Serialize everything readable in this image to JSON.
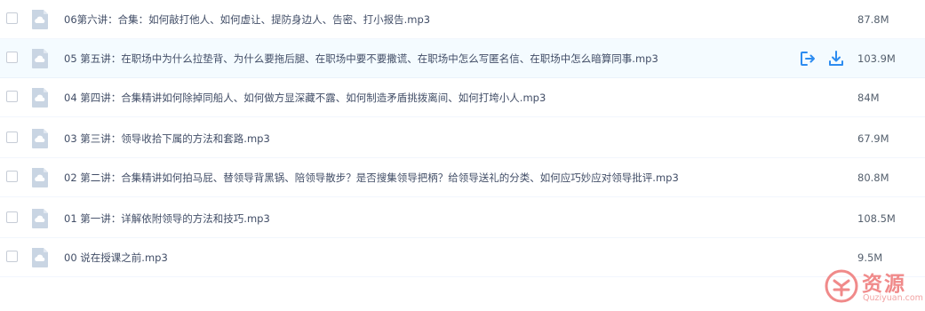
{
  "files": [
    {
      "name": "06第六讲：合集：如何敲打他人、如何虚让、提防身边人、告密、打小报告.mp3",
      "size": "87.8M",
      "hover": false
    },
    {
      "name": "05 第五讲：在职场中为什么拉垫背、为什么要拖后腿、在职场中要不要撒谎、在职场中怎么写匿名信、在职场中怎么暗算同事.mp3",
      "size": "103.9M",
      "hover": true
    },
    {
      "name": "04 第四讲：合集精讲如何除掉同船人、如何做方显深藏不露、如何制造矛盾挑拨离间、如何打垮小人.mp3",
      "size": "84M",
      "hover": false
    },
    {
      "name": "03 第三讲：领导收拾下属的方法和套路.mp3",
      "size": "67.9M",
      "hover": false
    },
    {
      "name": "02 第二讲：合集精讲如何拍马屁、替领导背黑锅、陪领导散步？是否搜集领导把柄？给领导送礼的分类、如何应巧妙应对领导批评.mp3",
      "size": "80.8M",
      "hover": false
    },
    {
      "name": "01 第一讲：详解依附领导的方法和技巧.mp3",
      "size": "108.5M",
      "hover": false
    },
    {
      "name": "00 说在授课之前.mp3",
      "size": "9.5M",
      "hover": false
    }
  ],
  "icons": {
    "file": "audio-file-icon",
    "share": "share-icon",
    "download": "download-icon"
  },
  "colors": {
    "accent": "#2d8cf0",
    "file_icon": "#c9d5e3",
    "hover_bg": "#f4fbff",
    "watermark": "#f08a8a"
  },
  "watermark": {
    "text": "资源",
    "sub": "Quziyuan.com"
  }
}
